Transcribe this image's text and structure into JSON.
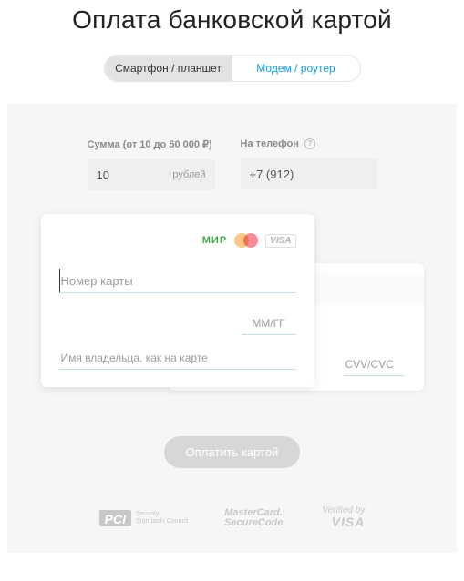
{
  "title": "Оплата банковской картой",
  "tabs": {
    "smartphone": "Смартфон / планшет",
    "modem": "Модем / роутер"
  },
  "amount": {
    "label": "Сумма (от 10 до 50 000 ₽)",
    "value": "10",
    "suffix": "рублей"
  },
  "phone": {
    "label": "На телефон",
    "value": "+7 (912)"
  },
  "card": {
    "logos": {
      "mir": "МИР",
      "visa": "VISA"
    },
    "number_placeholder": "Номер карты",
    "expiry_placeholder": "ММ/ГГ",
    "holder_placeholder": "Имя владельца, как на карте",
    "cvv_placeholder": "CVV/CVC"
  },
  "pay_button": "Оплатить картой",
  "footer": {
    "pci_badge": "PCI",
    "pci_text1": "Security",
    "pci_text2": "Standards Council",
    "mcsc1": "MasterCard.",
    "mcsc2": "SecureCode.",
    "vbv1": "Verified by",
    "vbv2": "VISA"
  }
}
